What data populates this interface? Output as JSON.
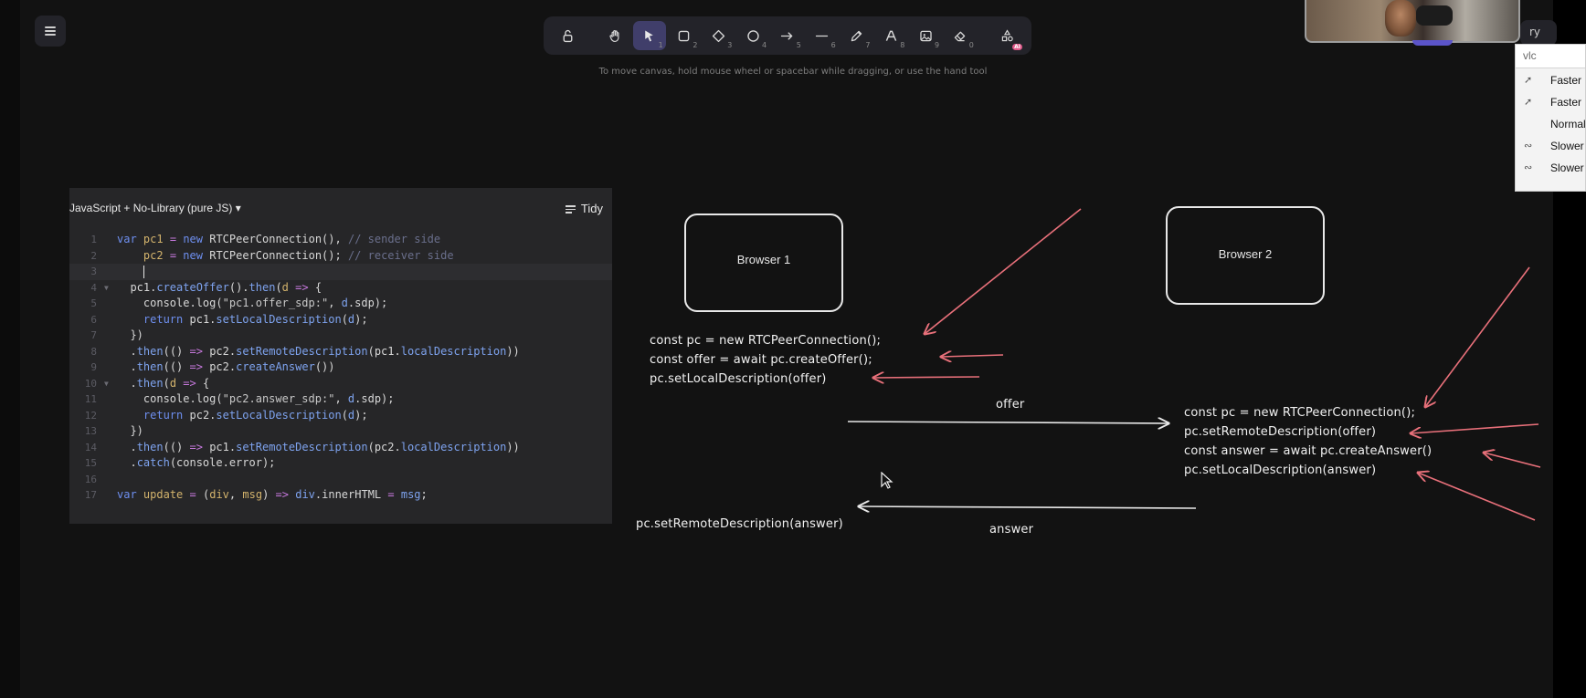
{
  "toolbar": {
    "tools": [
      {
        "name": "lock-icon",
        "num": ""
      },
      {
        "name": "hand-icon",
        "num": ""
      },
      {
        "name": "selection-icon",
        "num": "1"
      },
      {
        "name": "rectangle-icon",
        "num": "2"
      },
      {
        "name": "diamond-icon",
        "num": "3"
      },
      {
        "name": "ellipse-icon",
        "num": "4"
      },
      {
        "name": "arrow-icon",
        "num": "5"
      },
      {
        "name": "line-icon",
        "num": "6"
      },
      {
        "name": "pencil-icon",
        "num": "7"
      },
      {
        "name": "text-icon",
        "num": "8"
      },
      {
        "name": "image-icon",
        "num": "9"
      },
      {
        "name": "eraser-icon",
        "num": "0"
      },
      {
        "name": "more-tools-icon",
        "badge": "AI"
      }
    ],
    "hint": "To move canvas, hold mouse wheel or spacebar while dragging, or use the hand tool"
  },
  "top_right": {
    "chip_text": "ry"
  },
  "vlc_menu": {
    "search": "vlc",
    "items": [
      "Faster",
      "Faster (fine)",
      "Normal Speed",
      "Slower (fine)",
      "Slower"
    ]
  },
  "editor": {
    "language": "JavaScript + No-Library (pure JS)",
    "tidy_label": "Tidy",
    "line_numbers": [
      "1",
      "2",
      "3",
      "4",
      "5",
      "6",
      "7",
      "8",
      "9",
      "10",
      "11",
      "12",
      "13",
      "14",
      "15",
      "16",
      "17"
    ]
  },
  "whiteboard": {
    "browser1": "Browser 1",
    "browser2": "Browser 2",
    "offer_code": [
      "const pc = new RTCPeerConnection();",
      "const offer = await pc.createOffer();",
      "pc.setLocalDescription(offer)"
    ],
    "answer_code": [
      "const pc = new RTCPeerConnection();",
      "pc.setRemoteDescription(offer)",
      "const answer = await pc.createAnswer()",
      "pc.setLocalDescription(answer)"
    ],
    "offer_label": "offer",
    "answer_label": "answer",
    "remote_answer": "pc.setRemoteDescription(answer)"
  },
  "colors": {
    "canvas": "#121212",
    "toolbar": "#232329",
    "active_tool": "#403e6a",
    "annotation_red": "#e8707a"
  }
}
